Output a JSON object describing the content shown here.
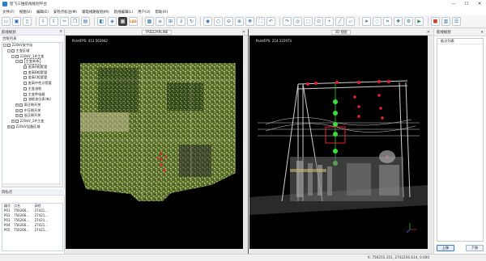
{
  "window": {
    "title": "智飞三维航线规划平台",
    "minimize": "—",
    "maximize": "☐",
    "close": "✕"
  },
  "menu": [
    "文件(F)",
    "视图(V)",
    "编辑(E)",
    "安检点标注(M)",
    "输电线路规划(M)",
    "航线编辑(L)",
    "用户(U)",
    "帮助(H)"
  ],
  "toolbar": {
    "buttons": [
      "folder-open-icon",
      "save-icon",
      "new-file-icon",
      "import-icon",
      "export-icon",
      "cut-icon",
      "copy-icon",
      "paste-icon",
      "image-icon",
      "bookmark-icon",
      "grid-icon",
      "cube-icon",
      "grid-2-icon",
      "align-icon",
      "measure-icon",
      "download-icon",
      "rotate-icon",
      "lock-icon",
      "unlock-icon",
      "zoom-out-icon",
      "zoom-in-icon",
      "pan-icon",
      "fit-icon",
      "undo-icon",
      "redo-icon",
      "compass-icon",
      "zoom-rect-icon",
      "target-icon",
      "point-icon",
      "line-icon",
      "area-icon",
      "cursor-icon",
      "lasso-icon",
      "crop-icon",
      "add-icon",
      "settings-icon",
      "play-icon",
      "stop-icon",
      "chart-icon",
      "list-icon"
    ],
    "highlight_index": 11,
    "highlight_label": "LAS"
  },
  "left_panel": {
    "title": "航线规划",
    "close": "✕",
    "tree_title": "台账列表",
    "tree": [
      {
        "indent": 0,
        "toggle": "-",
        "label": "220kV安宁站"
      },
      {
        "indent": 1,
        "toggle": "-",
        "label": "主变区域"
      },
      {
        "indent": 2,
        "toggle": "-",
        "label": "220kV_1#主变"
      },
      {
        "indent": 3,
        "toggle": "-",
        "label": "主变本体"
      },
      {
        "indent": 4,
        "toggle": "",
        "label": "变高A相套管"
      },
      {
        "indent": 4,
        "toggle": "",
        "label": "变高B相套管"
      },
      {
        "indent": 4,
        "toggle": "",
        "label": "变高C相套管"
      },
      {
        "indent": 4,
        "toggle": "",
        "label": "变高中性点套管"
      },
      {
        "indent": 4,
        "toggle": "",
        "label": "主变油枕"
      },
      {
        "indent": 4,
        "toggle": "",
        "label": "主变呼吸器"
      },
      {
        "indent": 4,
        "toggle": "",
        "label": "油枕油位表(有)"
      },
      {
        "indent": 3,
        "toggle": "+",
        "label": "高压侧开关"
      },
      {
        "indent": 3,
        "toggle": "+",
        "label": "中压侧开关"
      },
      {
        "indent": 3,
        "toggle": "+",
        "label": "低压侧开关"
      },
      {
        "indent": 2,
        "toggle": "+",
        "label": "220kV_2#主变"
      },
      {
        "indent": 1,
        "toggle": "+",
        "label": "220kV设备区域"
      }
    ],
    "targets_title": "目标点",
    "table": {
      "headers": [
        "编号",
        "点名",
        "高程"
      ],
      "rows": [
        [
          "P01",
          "756266...",
          "27421..."
        ],
        [
          "P02",
          "756266...",
          "27421..."
        ],
        [
          "P03",
          "756266...",
          "27421..."
        ],
        [
          "P04",
          "756266...",
          "27421..."
        ],
        [
          "P05",
          "756266...",
          "27421..."
        ]
      ]
    }
  },
  "view_left": {
    "tab": "FRED2ARLINE",
    "fps": "PointFPS: 413.563942"
  },
  "view_right": {
    "tab": "3D 视图",
    "fps": "PointFPS: 214.122973"
  },
  "right_panel": {
    "title": "航线规划",
    "close": "✕",
    "list_header": "航点列表",
    "btn_up": "上移",
    "btn_down": "下移"
  },
  "status": {
    "coords": "X: 756255.151, 2742256.614, 0.000"
  },
  "colors": {
    "accent": "#2a7bd4",
    "waypoint_red": "#e5232b",
    "waypoint_green": "#3ae03a",
    "cloud_green": "#6a8f2a"
  }
}
